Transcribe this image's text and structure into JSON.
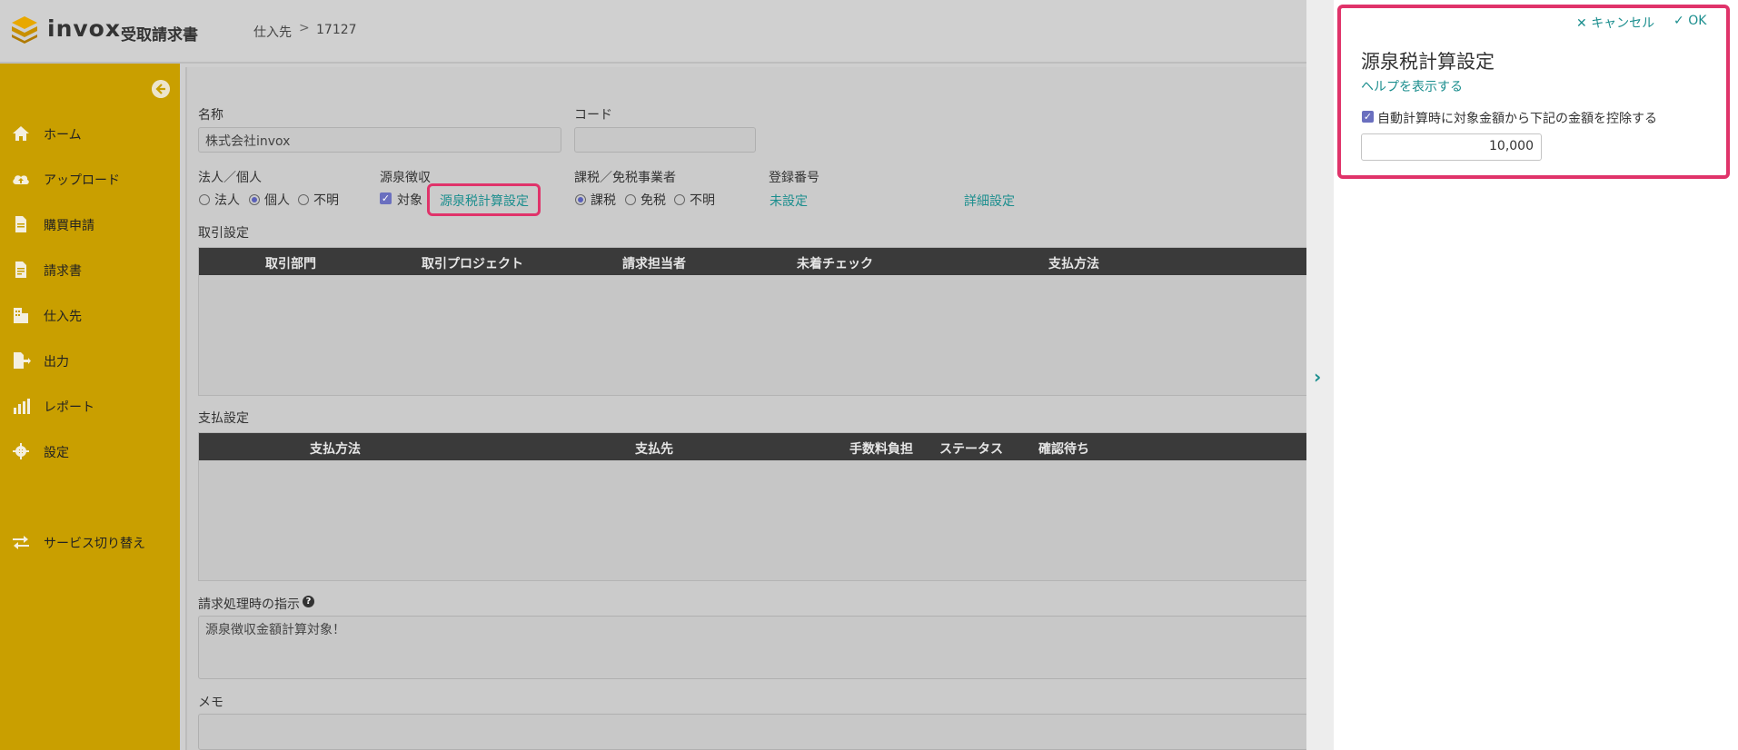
{
  "header": {
    "brand": "invox",
    "brand_sub": "受取請求書",
    "breadcrumb": {
      "item1": "仕入先",
      "separator": ">",
      "item2": "17127"
    }
  },
  "sidebar": {
    "items": [
      {
        "label": "ホーム",
        "icon": "home-icon"
      },
      {
        "label": "アップロード",
        "icon": "cloud-upload-icon"
      },
      {
        "label": "購買申請",
        "icon": "document-icon"
      },
      {
        "label": "請求書",
        "icon": "invoice-icon"
      },
      {
        "label": "仕入先",
        "icon": "building-icon"
      },
      {
        "label": "出力",
        "icon": "export-icon"
      },
      {
        "label": "レポート",
        "icon": "chart-icon"
      },
      {
        "label": "設定",
        "icon": "gear-icon"
      },
      {
        "label": "サービス切り替え",
        "icon": "switch-icon"
      }
    ]
  },
  "form": {
    "name_label": "名称",
    "name_value": "株式会社invox",
    "code_label": "コード",
    "code_value": "",
    "entity_label": "法人／個人",
    "entity_options": [
      "法人",
      "個人",
      "不明"
    ],
    "entity_selected": "個人",
    "withholding_label": "源泉徴収",
    "withholding_target_label": "対象",
    "withholding_checked": true,
    "withholding_link": "源泉税計算設定",
    "tax_label": "課税／免税事業者",
    "tax_options": [
      "課税",
      "免税",
      "不明"
    ],
    "tax_selected": "課税",
    "registration_label": "登録番号",
    "registration_value": "未設定",
    "detail_link": "詳細設定",
    "trade_section": "取引設定",
    "trade_columns": [
      "取引部門",
      "取引プロジェクト",
      "請求担当者",
      "未着チェック",
      "支払方法"
    ],
    "payment_section": "支払設定",
    "payment_columns": [
      "支払方法",
      "支払先",
      "手数料負担",
      "ステータス",
      "確認待ち"
    ],
    "instruction_label": "請求処理時の指示",
    "instruction_value": "源泉徴収金額計算対象！",
    "memo_label": "メモ"
  },
  "panel": {
    "cancel_label": "キャンセル",
    "ok_label": "OK",
    "title": "源泉税計算設定",
    "help_link": "ヘルプを表示する",
    "auto_calc_label": "自動計算時に対象金額から下記の金額を控除する",
    "auto_calc_checked": true,
    "deduction_amount": "10,000"
  },
  "colors": {
    "sidebar_bg": "#c99f00",
    "accent_teal": "#1b8e8e",
    "highlight_pink": "#e0336a",
    "table_header_bg": "#3a3a3a",
    "checkbox": "#6a6fbf"
  }
}
